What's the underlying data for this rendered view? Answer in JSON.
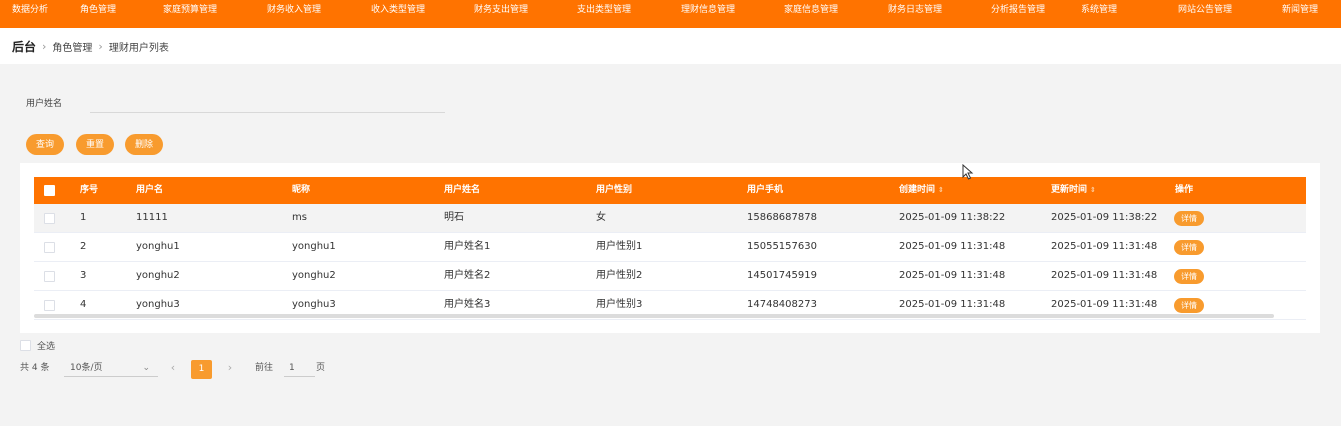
{
  "nav": {
    "items": [
      "数据分析",
      "角色管理",
      "家庭预算管理",
      "财务收入管理",
      "收入类型管理",
      "财务支出管理",
      "支出类型管理",
      "理财信息管理",
      "家庭信息管理",
      "财务日志管理",
      "分析报告管理",
      "系统管理",
      "网站公告管理",
      "新闻管理"
    ]
  },
  "breadcrumb": {
    "root": "后台",
    "items": [
      "角色管理",
      "理财用户列表"
    ]
  },
  "search": {
    "label": "用户姓名",
    "value": "",
    "placeholder": ""
  },
  "buttons": {
    "query": "查询",
    "reset": "重置",
    "delete": "删除"
  },
  "table": {
    "headers": [
      "序号",
      "用户名",
      "昵称",
      "用户姓名",
      "用户性别",
      "用户手机",
      "创建时间",
      "更新时间",
      "操作"
    ],
    "sort_icon": "⇕",
    "action_label": "详情",
    "rows": [
      [
        "1",
        "11111",
        "ms",
        "明石",
        "女",
        "15868687878",
        "2025-01-09 11:38:22",
        "2025-01-09 11:38:22"
      ],
      [
        "2",
        "yonghu1",
        "yonghu1",
        "用户姓名1",
        "用户性别1",
        "15055157630",
        "2025-01-09 11:31:48",
        "2025-01-09 11:31:48"
      ],
      [
        "3",
        "yonghu2",
        "yonghu2",
        "用户姓名2",
        "用户性别2",
        "14501745919",
        "2025-01-09 11:31:48",
        "2025-01-09 11:31:48"
      ],
      [
        "4",
        "yonghu3",
        "yonghu3",
        "用户姓名3",
        "用户性别3",
        "14748408273",
        "2025-01-09 11:31:48",
        "2025-01-09 11:31:48"
      ]
    ]
  },
  "select_all": "全选",
  "pager": {
    "total": "共 4 条",
    "page_size": "10条/页",
    "prev": "‹",
    "current": "1",
    "next": "›",
    "goto_label": "前往",
    "goto_value": "1",
    "goto_unit": "页"
  },
  "colors": {
    "accent": "#ff7300",
    "button": "#f89b2e"
  }
}
